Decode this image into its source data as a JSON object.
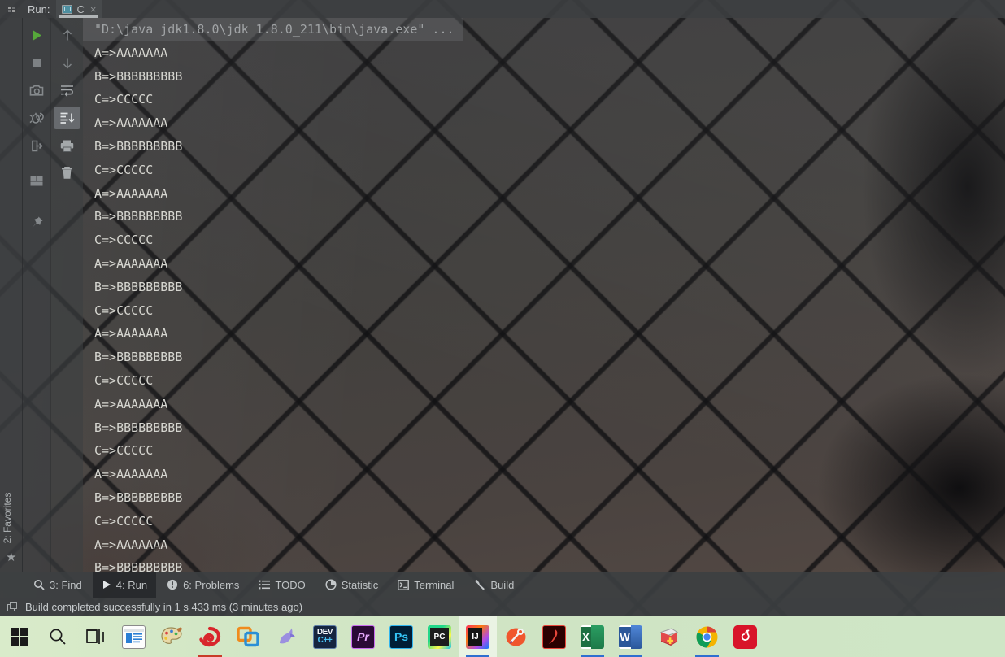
{
  "window": {
    "tool_window_label": "Run:",
    "run_config_name": "C",
    "close_tab_glyph": "×",
    "menu_icon": "app-menu-icon"
  },
  "left_strip": {
    "label_prefix": "2",
    "label": "2: Favorites",
    "star_glyph": "★"
  },
  "toolbar_primary": [
    {
      "name": "rerun-button",
      "icon": "play-icon",
      "tooltip": "Rerun"
    },
    {
      "name": "stop-button",
      "icon": "stop-square-icon",
      "tooltip": "Stop"
    },
    {
      "name": "screenshot-button",
      "icon": "camera-icon",
      "tooltip": "Screenshot"
    },
    {
      "name": "restart-debug-button",
      "icon": "bug-restart-icon",
      "tooltip": "Restart"
    },
    {
      "name": "dump-threads-button",
      "icon": "export-arrow-icon",
      "tooltip": "Dump Threads"
    },
    {
      "name": "layout-button",
      "icon": "layout-panels-icon",
      "tooltip": "Layout"
    },
    {
      "name": "pin-tab-button",
      "icon": "pin-icon",
      "tooltip": "Pin Tab"
    }
  ],
  "toolbar_secondary": [
    {
      "name": "scroll-up-button",
      "icon": "arrow-up-icon",
      "tooltip": "Up the Stack Trace",
      "selected": false
    },
    {
      "name": "scroll-down-button",
      "icon": "arrow-down-icon",
      "tooltip": "Down the Stack Trace",
      "selected": false
    },
    {
      "name": "soft-wrap-button",
      "icon": "soft-wrap-icon",
      "tooltip": "Use Soft Wraps",
      "selected": false
    },
    {
      "name": "scroll-to-end-button",
      "icon": "scroll-to-end-icon",
      "tooltip": "Scroll to the end",
      "selected": true
    },
    {
      "name": "print-button",
      "icon": "printer-icon",
      "tooltip": "Print",
      "selected": false
    },
    {
      "name": "clear-all-button",
      "icon": "trash-icon",
      "tooltip": "Clear All",
      "selected": false
    }
  ],
  "console": {
    "command_line": "\"D:\\java jdk1.8.0\\jdk 1.8.0_211\\bin\\java.exe\" ...",
    "lines": [
      "A=>AAAAAAA",
      "B=>BBBBBBBBB",
      "C=>CCCCC",
      "A=>AAAAAAA",
      "B=>BBBBBBBBB",
      "C=>CCCCC",
      "A=>AAAAAAA",
      "B=>BBBBBBBBB",
      "C=>CCCCC",
      "A=>AAAAAAA",
      "B=>BBBBBBBBB",
      "C=>CCCCC",
      "A=>AAAAAAA",
      "B=>BBBBBBBBB",
      "C=>CCCCC",
      "A=>AAAAAAA",
      "B=>BBBBBBBBB",
      "C=>CCCCC",
      "A=>AAAAAAA",
      "B=>BBBBBBBBB",
      "C=>CCCCC",
      "A=>AAAAAAA",
      "B=>BBBBBBBBB"
    ],
    "text_color": "#d6d6d0",
    "command_color": "#a0a3a5"
  },
  "bottom_tabs": [
    {
      "name": "tab-find",
      "num": "3",
      "label": "3: Find",
      "icon": "magnifier-icon",
      "active": false
    },
    {
      "name": "tab-run",
      "num": "4",
      "label": "4: Run",
      "icon": "play-icon",
      "active": true
    },
    {
      "name": "tab-problems",
      "num": "6",
      "label": "6: Problems",
      "icon": "exclamation-circle-icon",
      "active": false
    },
    {
      "name": "tab-todo",
      "num": "",
      "label": "TODO",
      "icon": "list-icon",
      "active": false
    },
    {
      "name": "tab-statistic",
      "num": "",
      "label": "Statistic",
      "icon": "pie-chart-icon",
      "active": false
    },
    {
      "name": "tab-terminal",
      "num": "",
      "label": "Terminal",
      "icon": "terminal-icon",
      "active": false
    },
    {
      "name": "tab-build",
      "num": "",
      "label": "Build",
      "icon": "hammer-icon",
      "active": false
    }
  ],
  "status_bar": {
    "icon": "window-square-icon",
    "message": "Build completed successfully in 1 s 433 ms (3 minutes ago)"
  },
  "taskbar": {
    "background": "#d3e7c6",
    "items": [
      {
        "name": "start-button",
        "icon": "windows-logo-icon",
        "label": "",
        "color": "#1b1b1b",
        "active": false,
        "running": false
      },
      {
        "name": "search-button",
        "icon": "magnifier-icon",
        "label": "",
        "color": "#1b1b1b",
        "active": false,
        "running": false
      },
      {
        "name": "task-view-button",
        "icon": "task-view-icon",
        "label": "",
        "color": "#1b1b1b",
        "active": false,
        "running": false
      },
      {
        "name": "file-explorer-button",
        "icon": "file-explorer-icon",
        "label": "",
        "color": "#1f6fc4",
        "active": false,
        "running": false
      },
      {
        "name": "paint-button",
        "icon": "paint-palette-icon",
        "label": "",
        "color": "#d9a02b",
        "active": false,
        "running": false
      },
      {
        "name": "recorder-button",
        "icon": "red-spiral-icon",
        "label": "",
        "color": "#d92b2b",
        "active": false,
        "running": true
      },
      {
        "name": "vmware-button",
        "icon": "vmware-icon",
        "label": "",
        "color": "#f08b1d",
        "active": false,
        "running": false
      },
      {
        "name": "navicat-button",
        "icon": "dolphin-icon",
        "label": "",
        "color": "#8e7fd6",
        "active": false,
        "running": false
      },
      {
        "name": "devcpp-button",
        "icon": "devcpp-icon",
        "label": "DEV",
        "color": "#1b2a4a",
        "active": false,
        "running": false
      },
      {
        "name": "premiere-button",
        "icon": "premiere-pro-icon",
        "label": "Pr",
        "color": "#2a0a36",
        "active": false,
        "running": false
      },
      {
        "name": "photoshop-button",
        "icon": "photoshop-icon",
        "label": "Ps",
        "color": "#001e36",
        "active": false,
        "running": false
      },
      {
        "name": "pycharm-button",
        "icon": "pycharm-icon",
        "label": "PC",
        "color": "#21d789",
        "active": false,
        "running": false
      },
      {
        "name": "intellij-button",
        "icon": "intellij-idea-icon",
        "label": "IJ",
        "color": "#fe315d",
        "active": true,
        "running": true
      },
      {
        "name": "snipaste-button",
        "icon": "orange-tool-icon",
        "label": "",
        "color": "#f0562d",
        "active": false,
        "running": false
      },
      {
        "name": "acrobat-button",
        "icon": "adobe-acrobat-icon",
        "label": "",
        "color": "#b30b00",
        "active": false,
        "running": false
      },
      {
        "name": "excel-button",
        "icon": "excel-icon",
        "label": "X",
        "color": "#1d6f42",
        "active": false,
        "running": true
      },
      {
        "name": "word-button",
        "icon": "word-icon",
        "label": "W",
        "color": "#2b579a",
        "active": false,
        "running": true
      },
      {
        "name": "notepadpp-button",
        "icon": "notepad-plus-icon",
        "label": "",
        "color": "#e2494b",
        "active": false,
        "running": false
      },
      {
        "name": "chrome-button",
        "icon": "chrome-icon",
        "label": "",
        "color": "#4285f4",
        "active": false,
        "running": true
      },
      {
        "name": "netease-music-button",
        "icon": "netease-music-icon",
        "label": "",
        "color": "#d8142a",
        "active": false,
        "running": false
      }
    ]
  }
}
